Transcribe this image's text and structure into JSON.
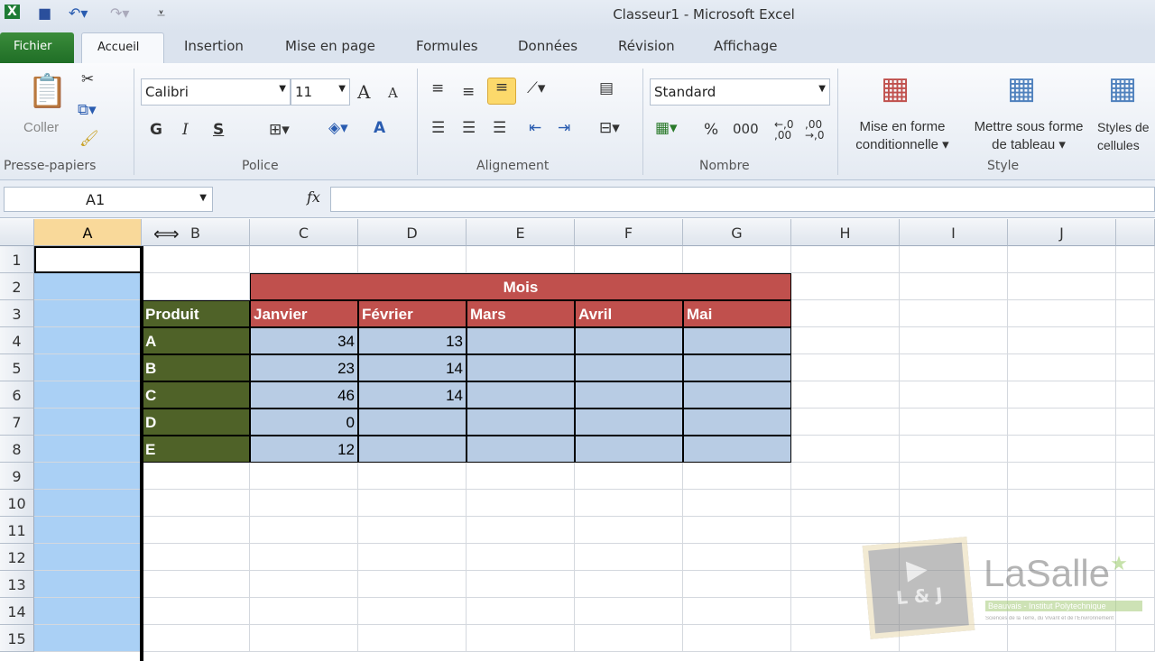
{
  "window": {
    "title": "Classeur1  -  Microsoft Excel"
  },
  "tabs": [
    "Fichier",
    "Accueil",
    "Insertion",
    "Mise en page",
    "Formules",
    "Données",
    "Révision",
    "Affichage"
  ],
  "ribbon": {
    "clipboard": {
      "paste": "Coller",
      "label": "Presse-papiers"
    },
    "font": {
      "name": "Calibri",
      "size": "11",
      "bold": "G",
      "italic": "I",
      "underline": "S",
      "grow": "A",
      "shrink": "A",
      "color": "A",
      "label": "Police"
    },
    "alignment": {
      "label": "Alignement"
    },
    "number": {
      "format": "Standard",
      "percent": "%",
      "thousands": "000",
      "label": "Nombre"
    },
    "style": {
      "conditional": "Mise en forme",
      "conditional2": "conditionnelle",
      "table": "Mettre sous forme",
      "table2": "de tableau",
      "cell": "Styles de",
      "cell2": "cellules",
      "label": "Style"
    }
  },
  "formula_bar": {
    "name_box": "A1",
    "fx": "fx",
    "value": ""
  },
  "columns": [
    "A",
    "B",
    "C",
    "D",
    "E",
    "F",
    "G",
    "H",
    "I",
    "J"
  ],
  "rows": [
    "1",
    "2",
    "3",
    "4",
    "5",
    "6",
    "7",
    "8",
    "9",
    "10",
    "11",
    "12",
    "13",
    "14",
    "15"
  ],
  "table": {
    "group_header": "Mois",
    "product_header": "Produit",
    "months": [
      "Janvier",
      "Février",
      "Mars",
      "Avril",
      "Mai"
    ],
    "products": [
      "A",
      "B",
      "C",
      "D",
      "E"
    ],
    "values": [
      [
        "34",
        "13",
        "",
        "",
        ""
      ],
      [
        "23",
        "14",
        "",
        "",
        ""
      ],
      [
        "46",
        "14",
        "",
        "",
        ""
      ],
      [
        "0",
        "",
        "",
        "",
        ""
      ],
      [
        "12",
        "",
        "",
        "",
        ""
      ]
    ]
  },
  "colors": {
    "header_red": "#c0504d",
    "product_green": "#4f6228",
    "data_blue": "#b8cce4",
    "selection": "#aad0f5"
  },
  "watermark": {
    "badge": "L & J",
    "brand": "LaSalle",
    "line1": "Beauvais - Institut Polytechnique",
    "line2": "Sciences de la Terre, du Vivant et de l'Environnement"
  }
}
